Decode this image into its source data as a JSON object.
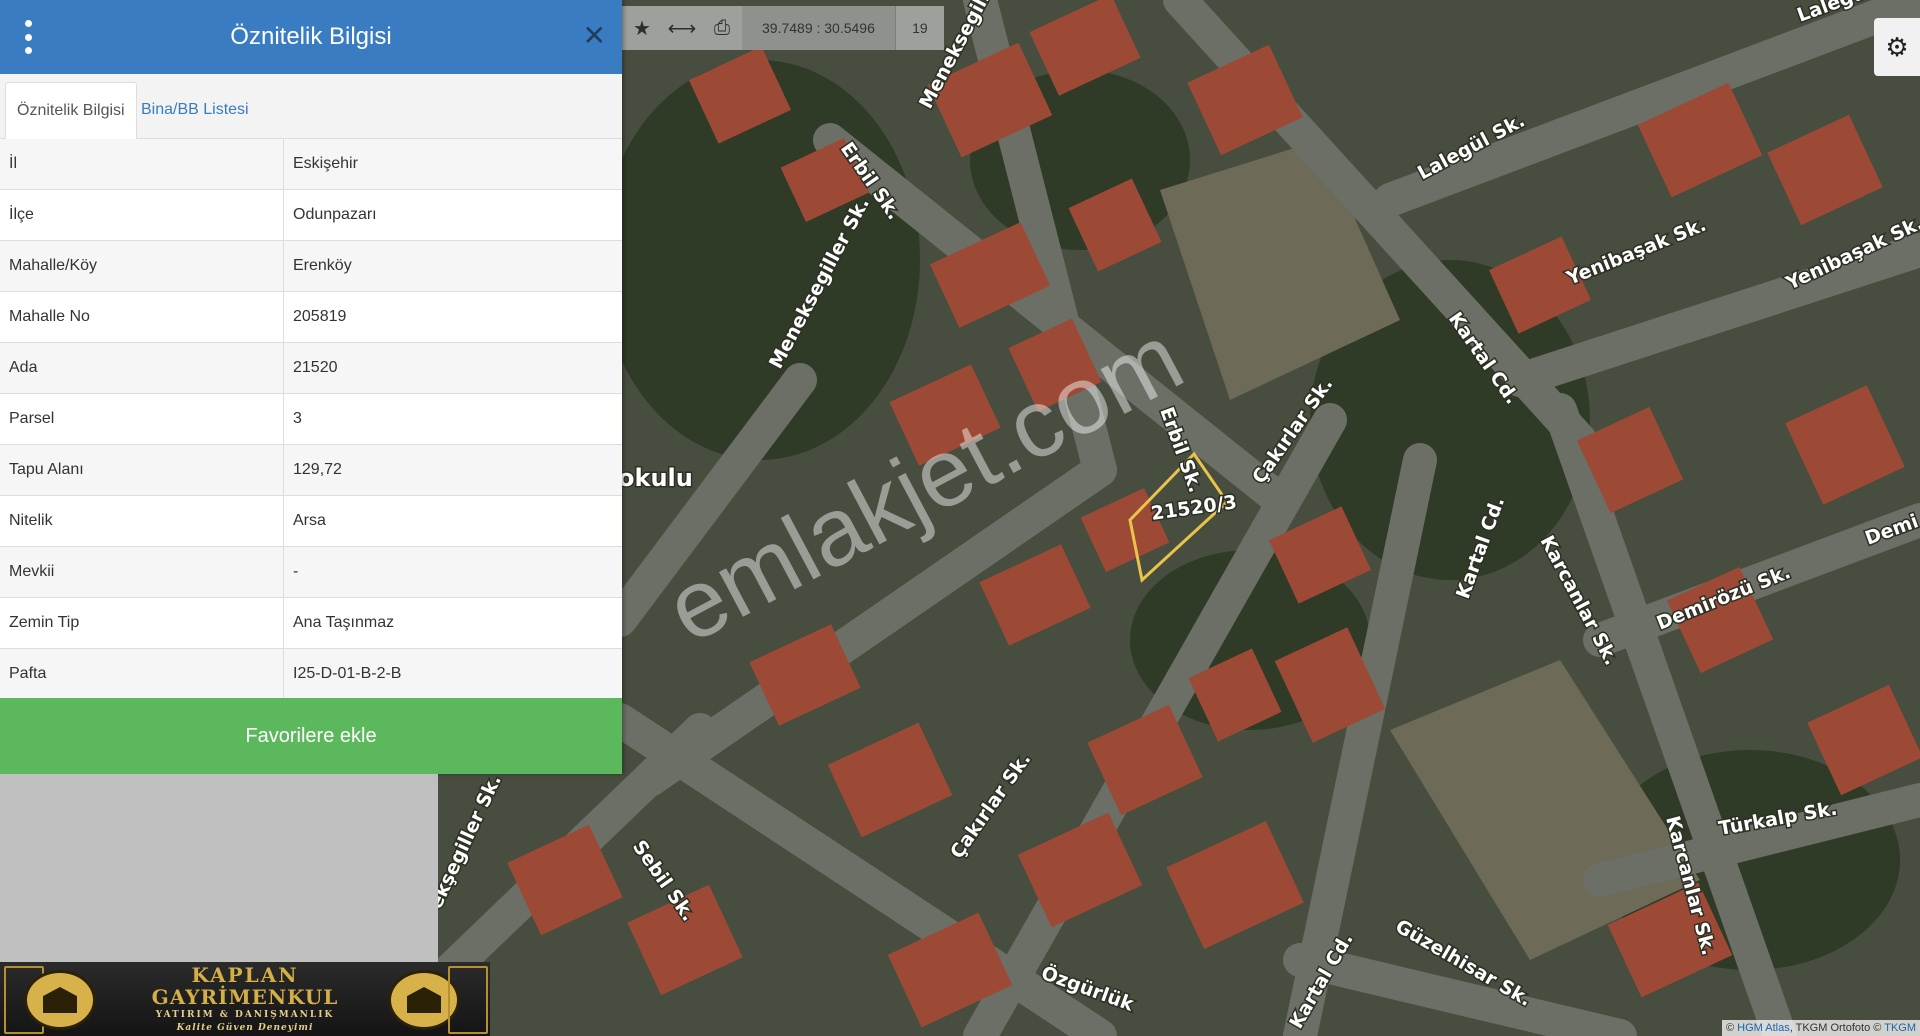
{
  "panel": {
    "title": "Öznitelik Bilgisi",
    "close_icon": "close-icon",
    "menu_icon": "more-vertical-icon",
    "tabs": [
      {
        "label": "Öznitelik Bilgisi",
        "active": true
      },
      {
        "label": "Bina/BB Listesi",
        "active": false
      }
    ],
    "rows": [
      {
        "key": "İl",
        "value": "Eskişehir"
      },
      {
        "key": "İlçe",
        "value": "Odunpazarı"
      },
      {
        "key": "Mahalle/Köy",
        "value": "Erenköy"
      },
      {
        "key": "Mahalle No",
        "value": "205819"
      },
      {
        "key": "Ada",
        "value": "21520"
      },
      {
        "key": "Parsel",
        "value": "3"
      },
      {
        "key": "Tapu Alanı",
        "value": "129,72"
      },
      {
        "key": "Nitelik",
        "value": "Arsa"
      },
      {
        "key": "Mevkii",
        "value": "-"
      },
      {
        "key": "Zemin Tip",
        "value": "Ana Taşınmaz"
      },
      {
        "key": "Pafta",
        "value": "I25-D-01-B-2-B"
      }
    ],
    "favorite_button": "Favorilere ekle"
  },
  "toolbar": {
    "icons": [
      "star-icon",
      "measure-icon",
      "print-icon"
    ],
    "coordinates": "39.7489 : 30.5496",
    "zoom": "19"
  },
  "map": {
    "parcel_label": "21520/3",
    "watermark": "emlakjet.com",
    "place_label": "okulu",
    "streets": [
      "Meneksegill",
      "Erbil Sk.",
      "Meneksegiller Sk.",
      "Lalegül Sk.",
      "Lalegul",
      "Yenibaşak Sk.",
      "Yenibaşak Sk.",
      "Kartal Cd.",
      "Erbil Sk.",
      "Çakırlar Sk.",
      "Kartal Cd.",
      "Karcanlar Sk.",
      "Demirözü Sk.",
      "Demi",
      "Karcanlar Sk.",
      "Türkalp Sk.",
      "Çakırlar Sk.",
      "Sebil Sk.",
      "ekşegiller Sk.",
      "Güzelhisar Sk.",
      "Kartal Cd.",
      "Özgürlük"
    ],
    "attribution_prefix": "© ",
    "attribution_link1": "HGM Atlas",
    "attribution_mid": ", TKGM Ortofoto © ",
    "attribution_link2": "TKGM",
    "settings_icon": "gear-icon",
    "colors": {
      "parcel_outline": "#e8c44a",
      "roof": "#9c4a36",
      "road": "#6b6f66"
    }
  },
  "logo": {
    "line1": "KAPLAN",
    "line2": "GAYRİMENKUL",
    "line3": "YATIRIM & DANIŞMANLIK",
    "line4": "Kalite Güven Deneyimi"
  },
  "colors": {
    "header": "#3a7cc1",
    "favorite": "#5cb85c"
  }
}
